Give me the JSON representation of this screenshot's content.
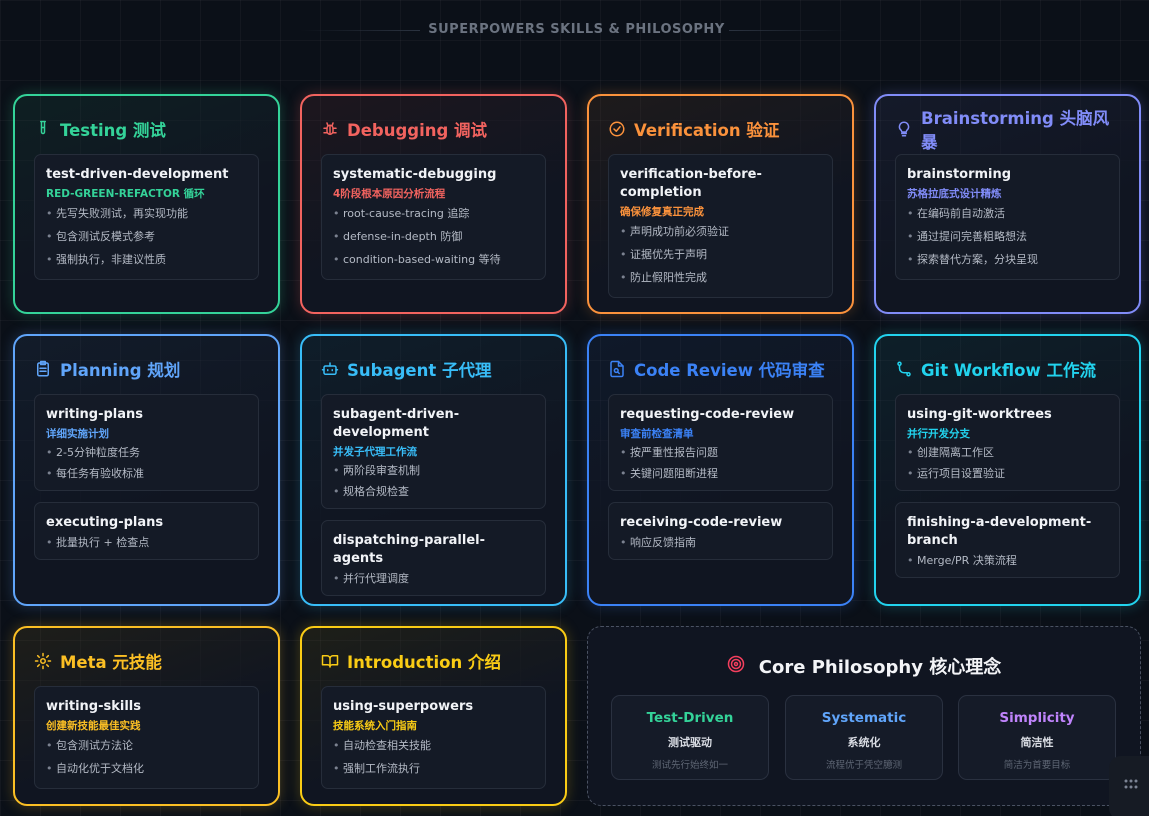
{
  "title": "SUPERPOWERS SKILLS & PHILOSOPHY",
  "cards": [
    {
      "id": "testing",
      "title": "Testing 测试",
      "icon": "test-tube-icon",
      "color": "#34d399",
      "skills": [
        {
          "name": "test-driven-development",
          "sub": "RED-GREEN-REFACTOR 循环",
          "bullets": [
            "先写失败测试，再实现功能",
            "包含测试反模式参考",
            "强制执行，非建议性质"
          ]
        }
      ]
    },
    {
      "id": "debugging",
      "title": "Debugging 调试",
      "icon": "bug-icon",
      "color": "#f2635f",
      "skills": [
        {
          "name": "systematic-debugging",
          "sub": "4阶段根本原因分析流程",
          "bullets": [
            "root-cause-tracing 追踪",
            "defense-in-depth 防御",
            "condition-based-waiting 等待"
          ]
        }
      ]
    },
    {
      "id": "verification",
      "title": "Verification 验证",
      "icon": "check-circle-icon",
      "color": "#fb923c",
      "skills": [
        {
          "name": "verification-before-completion",
          "sub": "确保修复真正完成",
          "bullets": [
            "声明成功前必须验证",
            "证据优先于声明",
            "防止假阳性完成"
          ]
        }
      ]
    },
    {
      "id": "brainstorming",
      "title": "Brainstorming 头脑风暴",
      "icon": "lightbulb-icon",
      "color": "#818cf8",
      "skills": [
        {
          "name": "brainstorming",
          "sub": "苏格拉底式设计精炼",
          "bullets": [
            "在编码前自动激活",
            "通过提问完善粗略想法",
            "探索替代方案，分块呈现"
          ]
        }
      ]
    },
    {
      "id": "planning",
      "title": "Planning 规划",
      "icon": "clipboard-icon",
      "color": "#60a5fa",
      "skills": [
        {
          "name": "writing-plans",
          "sub": "详细实施计划",
          "bullets": [
            "2-5分钟粒度任务",
            "每任务有验收标准"
          ]
        },
        {
          "name": "executing-plans",
          "sub": "",
          "bullets": [
            "批量执行 + 检查点"
          ]
        }
      ]
    },
    {
      "id": "subagent",
      "title": "Subagent 子代理",
      "icon": "robot-icon",
      "color": "#38bdf8",
      "skills": [
        {
          "name": "subagent-driven-development",
          "sub": "并发子代理工作流",
          "bullets": [
            "两阶段审查机制",
            "规格合规检查"
          ]
        },
        {
          "name": "dispatching-parallel-agents",
          "sub": "",
          "bullets": [
            "并行代理调度"
          ]
        }
      ]
    },
    {
      "id": "codereview",
      "title": "Code Review 代码审查",
      "icon": "file-search-icon",
      "color": "#3b82f6",
      "skills": [
        {
          "name": "requesting-code-review",
          "sub": "审查前检查清单",
          "bullets": [
            "按严重性报告问题",
            "关键问题阻断进程"
          ]
        },
        {
          "name": "receiving-code-review",
          "sub": "",
          "bullets": [
            "响应反馈指南"
          ]
        }
      ]
    },
    {
      "id": "git",
      "title": "Git Workflow 工作流",
      "icon": "git-branch-icon",
      "color": "#22d3ee",
      "skills": [
        {
          "name": "using-git-worktrees",
          "sub": "并行开发分支",
          "bullets": [
            "创建隔离工作区",
            "运行项目设置验证"
          ]
        },
        {
          "name": "finishing-a-development-branch",
          "sub": "",
          "bullets": [
            "Merge/PR 决策流程"
          ]
        }
      ]
    },
    {
      "id": "meta",
      "title": "Meta 元技能",
      "icon": "gear-icon",
      "color": "#fbbf24",
      "skills": [
        {
          "name": "writing-skills",
          "sub": "创建新技能最佳实践",
          "bullets": [
            "包含测试方法论",
            "自动化优于文档化"
          ]
        }
      ]
    },
    {
      "id": "intro",
      "title": "Introduction 介绍",
      "icon": "book-icon",
      "color": "#facc15",
      "skills": [
        {
          "name": "using-superpowers",
          "sub": "技能系统入门指南",
          "bullets": [
            "自动检查相关技能",
            "强制工作流执行"
          ]
        }
      ]
    }
  ],
  "philosophy": {
    "title": "Core Philosophy 核心理念",
    "icon": "target-icon",
    "icon_color": "#f43f5e",
    "items": [
      {
        "title": "Test-Driven",
        "sub": "测试驱动",
        "desc": "测试先行始终如一",
        "color": "#34d399"
      },
      {
        "title": "Systematic",
        "sub": "系统化",
        "desc": "流程优于凭空臆测",
        "color": "#60a5fa"
      },
      {
        "title": "Simplicity",
        "sub": "简洁性",
        "desc": "简洁为首要目标",
        "color": "#c084fc"
      }
    ]
  },
  "corner_button": {
    "icon": "grid-dots-icon"
  }
}
